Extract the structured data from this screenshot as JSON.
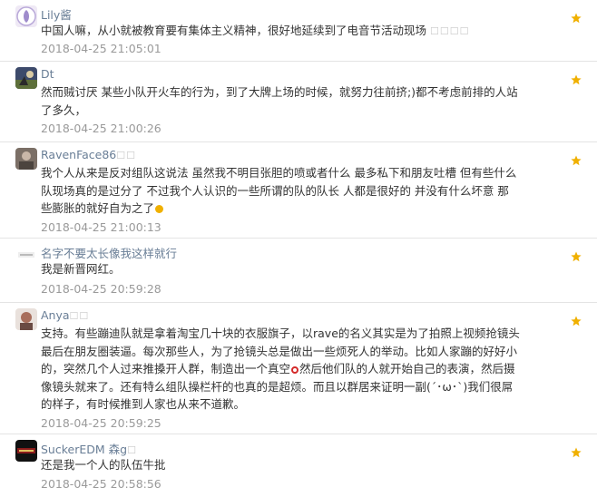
{
  "comments": [
    {
      "username": "Lily酱",
      "badge": "",
      "text": "中国人嘛，从小就被教育要有集体主义精神，很好地延续到了电音节活动现场",
      "suffix": "☐☐☐☐",
      "time": "2018-04-25 21:05:01"
    },
    {
      "username": "Dt",
      "badge": "",
      "text": "然而贼讨厌 某些小队开火车的行为，到了大牌上场的时候，就努力往前挤;)都不考虑前排的人站了多久，",
      "time": "2018-04-25 21:00:26"
    },
    {
      "username": "RavenFace86",
      "badge": "☐☐",
      "text": "我个人从来是反对组队这说法 虽然我不明目张胆的喷或者什么 最多私下和朋友吐槽 但有些什么队现场真的是过分了 不过我个人认识的一些所谓的队的队长 人都是很好的 并没有什么坏意 那些膨胀的就好自为之了",
      "time": "2018-04-25 21:00:13"
    },
    {
      "username": "名字不要太长像我这样就行",
      "badge": "",
      "text": "我是新晋网红。",
      "time": "2018-04-25 20:59:28"
    },
    {
      "username": "Anya",
      "badge": "☐☐",
      "text_a": "支持。有些蹦迪队就是拿着淘宝几十块的衣服旗子，以rave的名义其实是为了拍照上视频抢镜头最后在朋友圈装逼。每次那些人，为了抢镜头总是做出一些烦死人的举动。比如人家蹦的好好小的，突然几个人过来推搡开人群，制造出一个真空",
      "text_b": "然后他们队的人就开始自己的表演，然后摄像镜头就来了。还有特么组队操栏杆的也真的是超烦。而且以群居来证明一副(´･ω･`)我们很屌的样子，有时候推到人家也从来不道歉。",
      "time": "2018-04-25 20:59:25"
    },
    {
      "username": "SuckerEDM 森g",
      "badge": "☐",
      "text": "还是我一个人的队伍牛批",
      "time": "2018-04-25 20:58:56"
    }
  ],
  "colors": {
    "username": "#697e96",
    "text": "#333333",
    "time": "#9a9a9a",
    "divider": "#e4e4e4",
    "star": "#f0b000"
  },
  "icons": {
    "like": "star-icon"
  }
}
